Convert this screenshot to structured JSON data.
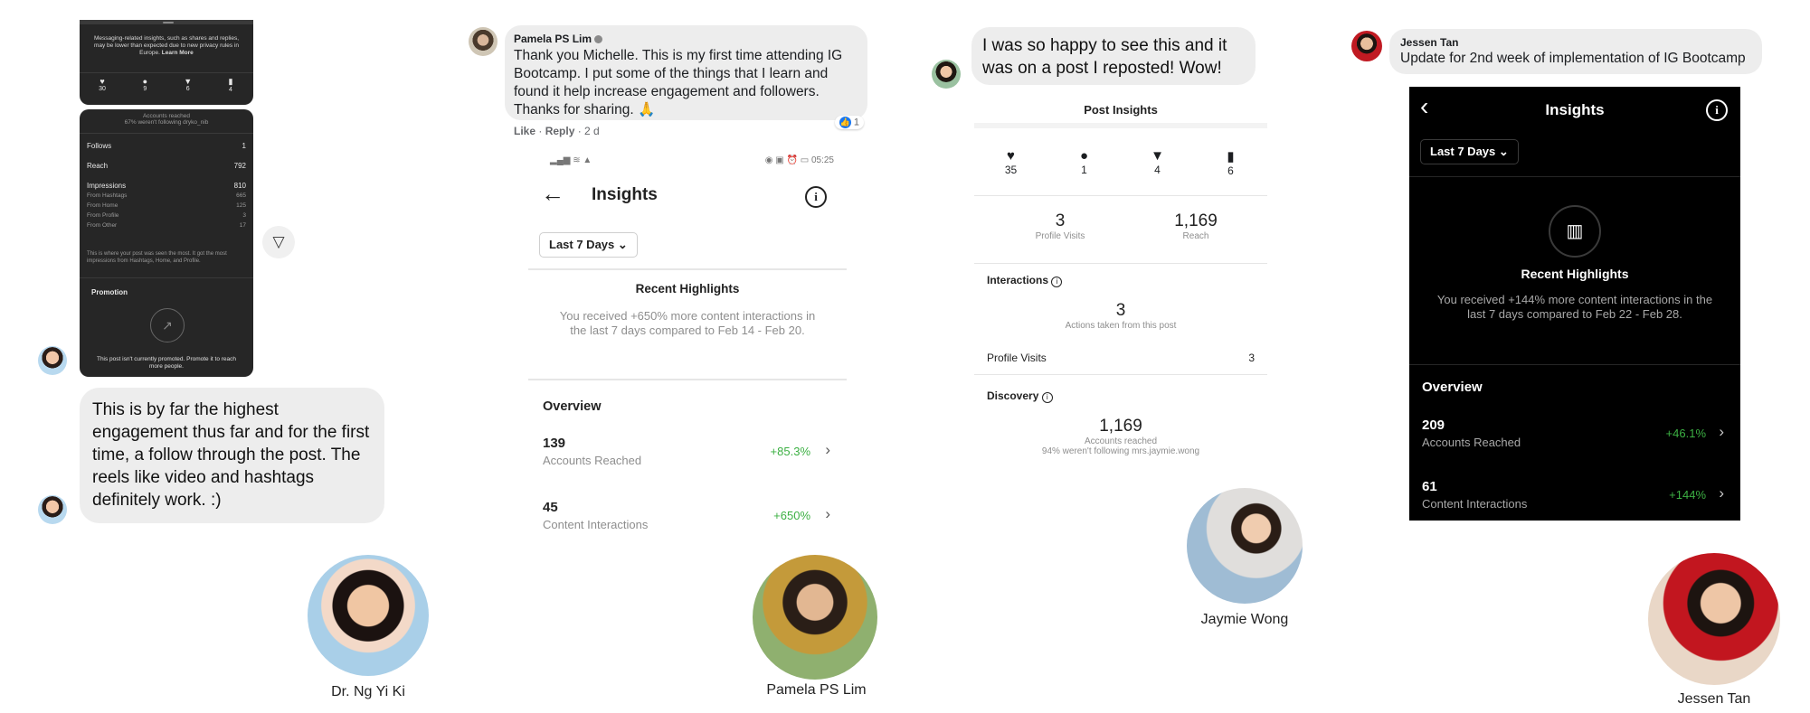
{
  "panel1": {
    "privacy_note": "Messaging-related insights, such as shares and replies, may be lower than expected due to new privacy rules in Europe.",
    "learn_more": "Learn More",
    "stats": [
      {
        "icon": "heart-icon",
        "value": "30"
      },
      {
        "icon": "comment-icon",
        "value": "9"
      },
      {
        "icon": "share-icon",
        "value": "6"
      },
      {
        "icon": "bookmark-icon",
        "value": "4"
      }
    ],
    "accounts_reached_title": "Accounts reached",
    "accounts_reached_sub": "67% weren't following dryko_nib",
    "follows_label": "Follows",
    "follows_value": "1",
    "reach_label": "Reach",
    "reach_value": "792",
    "impressions_label": "Impressions",
    "impressions_value": "810",
    "impression_sources": [
      {
        "label": "From Hashtags",
        "value": "665"
      },
      {
        "label": "From Home",
        "value": "125"
      },
      {
        "label": "From Profile",
        "value": "3"
      },
      {
        "label": "From Other",
        "value": "17"
      }
    ],
    "impressions_note": "This is where your post was seen the most. It got the most impressions from Hashtags, Home, and Profile.",
    "promotion_label": "Promotion",
    "promo_note": "This post isn't currently promoted. Promote it to reach more people.",
    "comment_text": "This is by far the highest engagement thus far and for the first time, a follow through the post. The reels like video and hashtags definitely work.  :)",
    "caption": "Dr. Ng Yi Ki"
  },
  "panel2": {
    "author": "Pamela PS Lim",
    "comment_text": "Thank you Michelle. This is my first time attending IG Bootcamp. I put some of the things that I learn and found it help increase engagement and followers. Thanks for sharing. 🙏",
    "like_label": "Like",
    "reply_label": "Reply",
    "age": "2 d",
    "reaction_count": "1",
    "status_time": "05:25",
    "title": "Insights",
    "range": "Last 7 Days",
    "highlights_title": "Recent Highlights",
    "highlights_text": "You received +650% more content interactions in the last 7 days compared to Feb 14 - Feb 20.",
    "overview_title": "Overview",
    "rows": [
      {
        "value": "139",
        "label": "Accounts Reached",
        "change": "+85.3%"
      },
      {
        "value": "45",
        "label": "Content Interactions",
        "change": "+650%"
      }
    ],
    "caption": "Pamela PS Lim"
  },
  "panel3": {
    "comment_text": "I was so happy to see this and it was on a post I reposted! Wow!",
    "post_insights_title": "Post Insights",
    "stats": [
      {
        "icon": "heart-icon",
        "value": "35"
      },
      {
        "icon": "comment-icon",
        "value": "1"
      },
      {
        "icon": "share-icon",
        "value": "4"
      },
      {
        "icon": "bookmark-icon",
        "value": "6"
      }
    ],
    "profile_visits_value": "3",
    "profile_visits_label": "Profile Visits",
    "reach_value": "1,169",
    "reach_label": "Reach",
    "interactions_title": "Interactions",
    "actions_value": "3",
    "actions_label": "Actions taken from this post",
    "profile_visits_row_label": "Profile Visits",
    "profile_visits_row_value": "3",
    "discovery_title": "Discovery",
    "accounts_reached_value": "1,169",
    "accounts_reached_label": "Accounts reached",
    "not_following_note": "94% weren't following mrs.jaymie.wong",
    "caption": "Jaymie Wong"
  },
  "panel4": {
    "author": "Jessen Tan",
    "comment_text": "Update for 2nd week of implementation of IG Bootcamp",
    "title": "Insights",
    "range": "Last 7 Days",
    "highlights_title": "Recent Highlights",
    "highlights_text": "You received +144% more content interactions in the last 7 days compared to Feb 22 - Feb 28.",
    "overview_title": "Overview",
    "rows": [
      {
        "value": "209",
        "label": "Accounts Reached",
        "change": "+46.1%"
      },
      {
        "value": "61",
        "label": "Content Interactions",
        "change": "+144%"
      }
    ],
    "caption": "Jessen Tan"
  },
  "colors": {
    "accent_green": "#3cb043",
    "bubble": "#ededed",
    "dark_panel": "#262626",
    "messenger_blue": "#1877f2"
  }
}
